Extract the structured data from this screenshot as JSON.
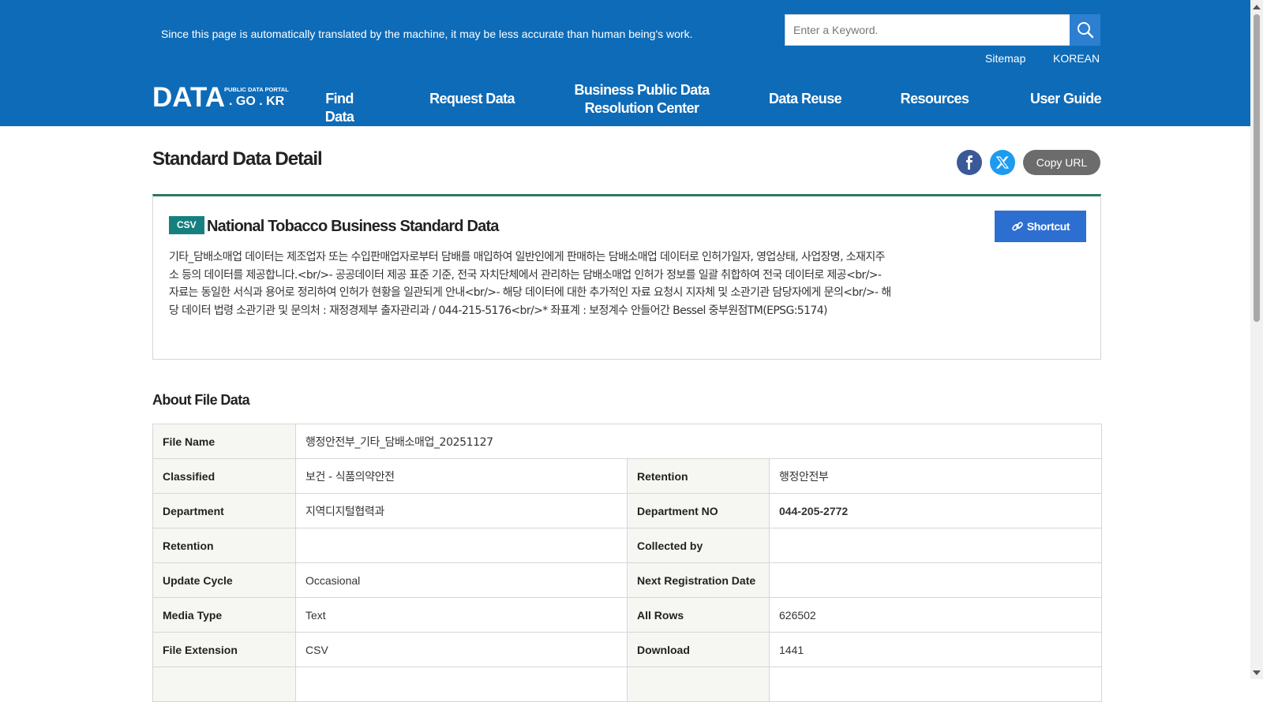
{
  "header": {
    "notice": "Since this page is automatically translated by the machine, it may be less accurate than human being's work.",
    "search_placeholder": "Enter a Keyword.",
    "sitemap": "Sitemap",
    "language": "KOREAN",
    "logo": {
      "main": "DATA",
      "sub": "PUBLIC DATA PORTAL",
      "domain": ". GO . KR"
    },
    "nav": [
      "Find Data",
      "Request Data",
      "Business Public Data Resolution Center",
      "Data Reuse",
      "Resources",
      "User Guide"
    ],
    "background_color": "#0e6bb8"
  },
  "page": {
    "title": "Standard Data Detail",
    "copy_url": "Copy URL",
    "share_icons": [
      "facebook-icon",
      "x-twitter-icon"
    ]
  },
  "dataset": {
    "badge": "CSV",
    "title": "National Tobacco Business Standard Data",
    "shortcut": "Shortcut",
    "description": "기타_담배소매업 데이터는 제조업자 또는 수입판매업자로부터 담배를 매입하여 일반인에게 판매하는 담배소매업 데이터로 인허가일자, 영업상태, 사업장명, 소재지주소 등의 데이터를 제공합니다.<br/>- 공공데이터 제공 표준 기준, 전국 자치단체에서 관리하는 담배소매업 인허가 정보를 일괄 취합하여 전국 데이터로 제공<br/>- 자료는 동일한 서식과 용어로 정리하여 인허가 현황을 일관되게 안내<br/>- 해당 데이터에 대한 추가적인 자료 요청시 지자체 및 소관기관 담당자에게 문의<br/>- 해당 데이터 법령 소관기관 및 문의처 : 재정경제부 출자관리과 / 044-215-5176<br/>* 좌표계 : 보정계수 안들어간 Bessel 중부원점TM(EPSG:5174)",
    "accent_color": "#2a7a5a"
  },
  "file_data": {
    "section_title": "About File Data",
    "file_name_label": "File Name",
    "file_name": "행정안전부_기타_담배소매업_20251127",
    "rows": [
      {
        "l1": "Classified",
        "v1": "보건 - 식품의약안전",
        "l2": "Retention",
        "v2": "행정안전부"
      },
      {
        "l1": "Department",
        "v1": "지역디지털협력과",
        "l2": "Department NO",
        "v2": "044-205-2772"
      },
      {
        "l1": "Retention",
        "v1": "",
        "l2": "Collected by",
        "v2": ""
      },
      {
        "l1": "Update Cycle",
        "v1": "Occasional",
        "l2": "Next Registration Date",
        "v2": ""
      },
      {
        "l1": "Media Type",
        "v1": "Text",
        "l2": "All Rows",
        "v2": "626502"
      },
      {
        "l1": "File Extension",
        "v1": "CSV",
        "l2": "Download",
        "v2": "1441"
      }
    ]
  }
}
